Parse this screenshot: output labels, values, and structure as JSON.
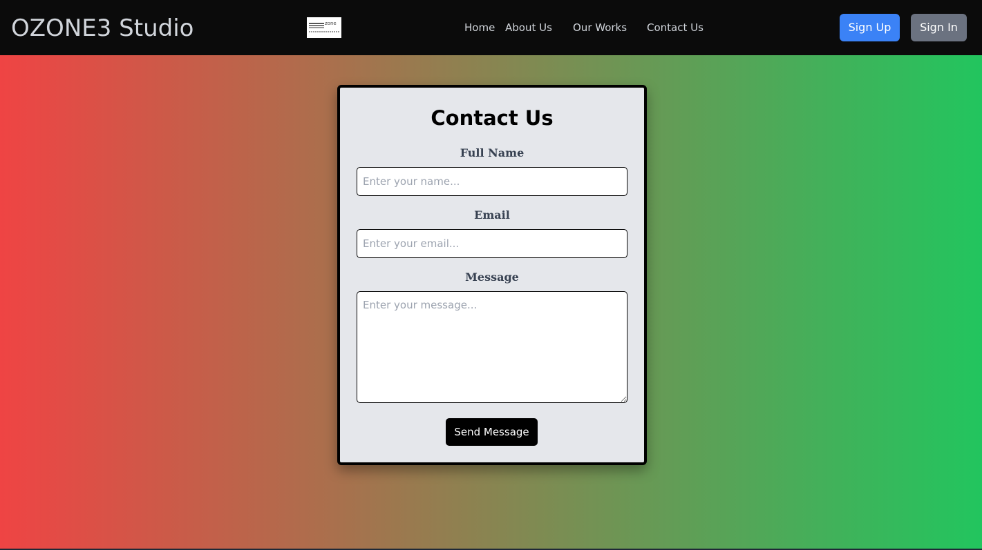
{
  "header": {
    "brand": "OZONE3 Studio",
    "logo_text": "zone",
    "nav": {
      "home": "Home",
      "about": "About Us",
      "works": "Our Works",
      "contact": "Contact Us"
    },
    "sign_up": "Sign Up",
    "sign_in": "Sign In"
  },
  "contact_form": {
    "title": "Contact Us",
    "name_label": "Full Name",
    "name_placeholder": "Enter your name...",
    "email_label": "Email",
    "email_placeholder": "Enter your email...",
    "message_label": "Message",
    "message_placeholder": "Enter your message...",
    "submit_label": "Send Message"
  },
  "colors": {
    "navbar_bg": "#0b0b0b",
    "gradient_start": "#ef4444",
    "gradient_end": "#22c55e",
    "sign_up_bg": "#3b82f6",
    "sign_in_bg": "#6b7280",
    "card_bg": "#e5e7eb"
  },
  "icons": {
    "logo": "ozone-logo-icon"
  }
}
